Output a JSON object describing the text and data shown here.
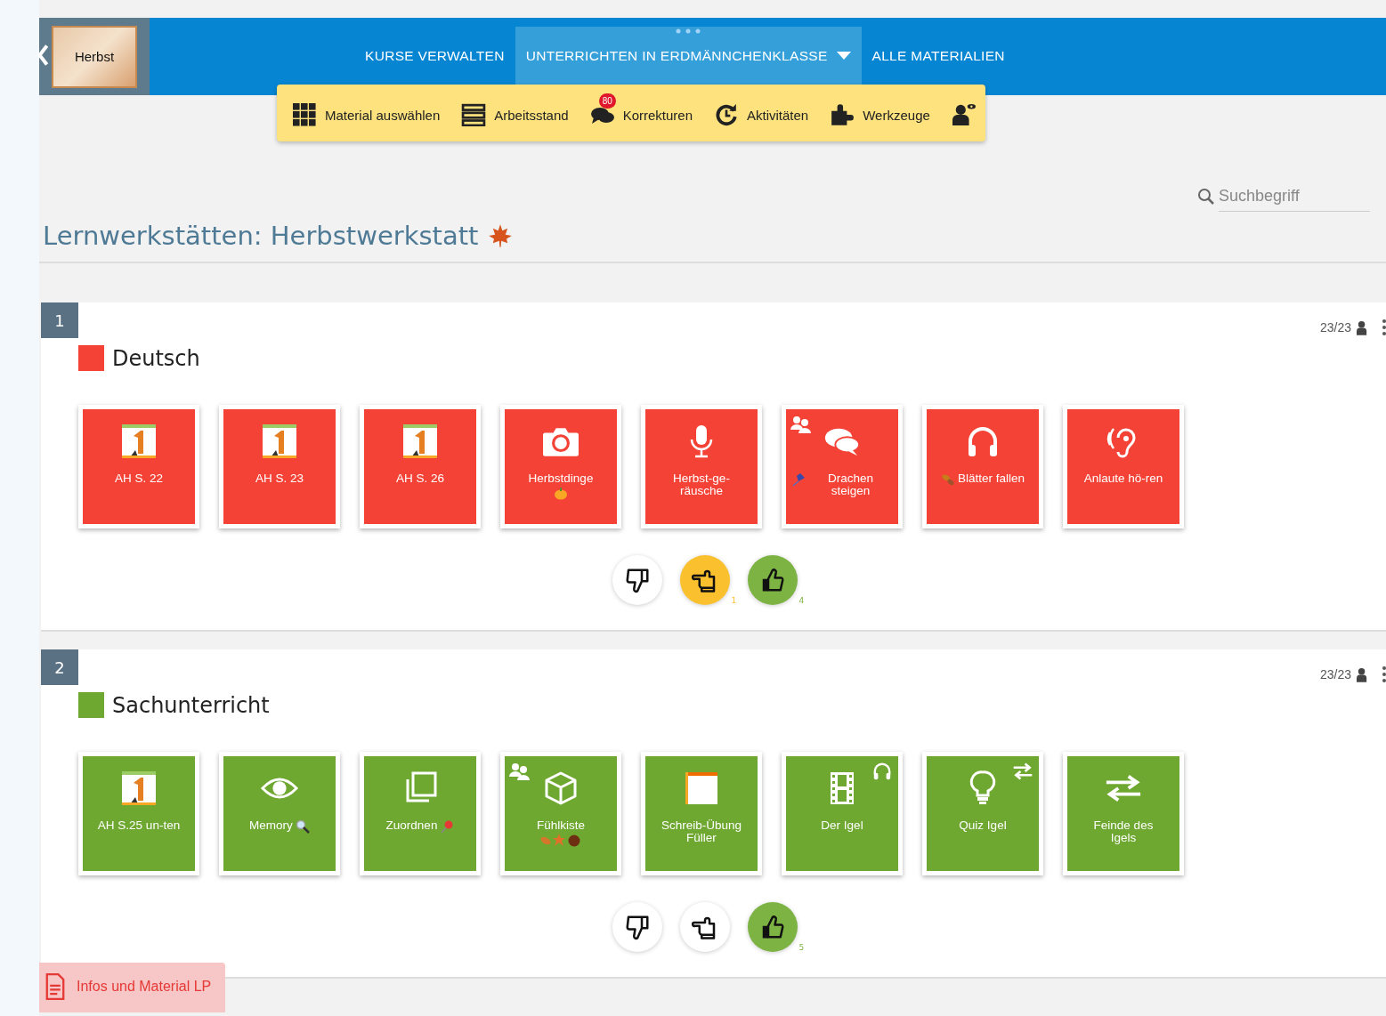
{
  "header": {
    "thumbnail_label": "Herbst",
    "tabs": [
      {
        "label": "KURSE VERWALTEN",
        "selected": false,
        "dropdown": false
      },
      {
        "label": "UNTERRICHTEN IN ERDMÄNNCHENKLASSE",
        "selected": true,
        "dropdown": true
      },
      {
        "label": "ALLE MATERIALIEN",
        "selected": false,
        "dropdown": false
      }
    ]
  },
  "toolbar": [
    {
      "kind": "grid",
      "label": "Material auswählen"
    },
    {
      "kind": "list",
      "label": "Arbeitsstand"
    },
    {
      "kind": "comments",
      "label": "Korrekturen",
      "badge": "80"
    },
    {
      "kind": "history",
      "label": "Aktivitäten"
    },
    {
      "kind": "puzzle",
      "label": "Werkzeuge"
    },
    {
      "kind": "viewer"
    }
  ],
  "search": {
    "placeholder": "Suchbegriff"
  },
  "page_title": "Lernwerkstätten: Herbstwerkstatt",
  "sections": [
    {
      "number": "1",
      "subject": "Deutsch",
      "color": "#f44336",
      "count": "23/23",
      "tiles": [
        {
          "kind": "book",
          "label": "AH S. 22"
        },
        {
          "kind": "book",
          "label": "AH S. 23"
        },
        {
          "kind": "book",
          "label": "AH S. 26"
        },
        {
          "kind": "camera",
          "label": "Herbstdinge",
          "decorations": [
            {
              "kind": "pumpkin"
            }
          ]
        },
        {
          "kind": "mic",
          "label": "Herbst-ge-räusche"
        },
        {
          "kind": "chat",
          "label": "Drachen steigen",
          "decorations": [
            {
              "kind": "kite"
            },
            {
              "kind": "group"
            }
          ]
        },
        {
          "kind": "headphones",
          "label": "Blätter fallen",
          "decorations": [
            {
              "kind": "leaf"
            }
          ]
        },
        {
          "kind": "ear",
          "label": "Anlaute hö-ren"
        }
      ],
      "ratings": [
        {
          "kind": "down",
          "selected": false
        },
        {
          "kind": "neutral",
          "selected": true,
          "count": "1"
        },
        {
          "kind": "up",
          "selected": true,
          "count": "4"
        }
      ]
    },
    {
      "number": "2",
      "subject": "Sachunterricht",
      "color": "#6fa830",
      "count": "23/23",
      "tiles": [
        {
          "kind": "book",
          "label": "AH S.25 un-ten"
        },
        {
          "kind": "eye",
          "label": "Memory",
          "decorations": [
            {
              "kind": "magnifier"
            }
          ]
        },
        {
          "kind": "copy",
          "label": "Zuordnen",
          "decorations": [
            {
              "kind": "pin"
            }
          ]
        },
        {
          "kind": "cube",
          "label": "Fühlkiste",
          "decorations": [
            {
              "kind": "autumn"
            },
            {
              "kind": "group"
            }
          ]
        },
        {
          "kind": "sheet",
          "label": "Schreib-Übung Füller"
        },
        {
          "kind": "film",
          "label": "Der Igel",
          "decorations": [
            {
              "kind": "headphones"
            }
          ]
        },
        {
          "kind": "bulb",
          "label": "Quiz Igel",
          "decorations": [
            {
              "kind": "arrows"
            }
          ]
        },
        {
          "kind": "arrows",
          "label": "Feinde des Igels"
        }
      ],
      "ratings": [
        {
          "kind": "down",
          "selected": false
        },
        {
          "kind": "neutral",
          "selected": false
        },
        {
          "kind": "up",
          "selected": true,
          "count": "5"
        }
      ]
    }
  ],
  "footer_tab": {
    "label": "Infos und Material LP"
  }
}
